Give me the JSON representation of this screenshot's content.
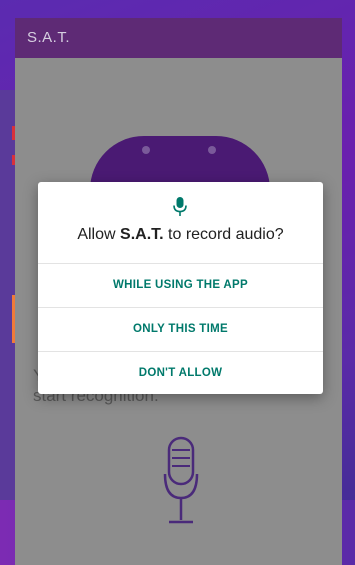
{
  "app": {
    "title": "S.A.T."
  },
  "main": {
    "instruction": "You can tap the mic button below to start recognition."
  },
  "dialog": {
    "title_prefix": "Allow ",
    "app_name": "S.A.T.",
    "title_suffix": " to record audio?",
    "buttons": {
      "while_using": "WHILE USING THE APP",
      "only_this_time": "ONLY THIS TIME",
      "dont_allow": "DON'T ALLOW"
    }
  },
  "colors": {
    "accent": "#00796b",
    "appbar": "#5e2a75"
  },
  "icons": {
    "dialog_icon": "microphone-icon",
    "main_icon": "microphone-icon"
  }
}
